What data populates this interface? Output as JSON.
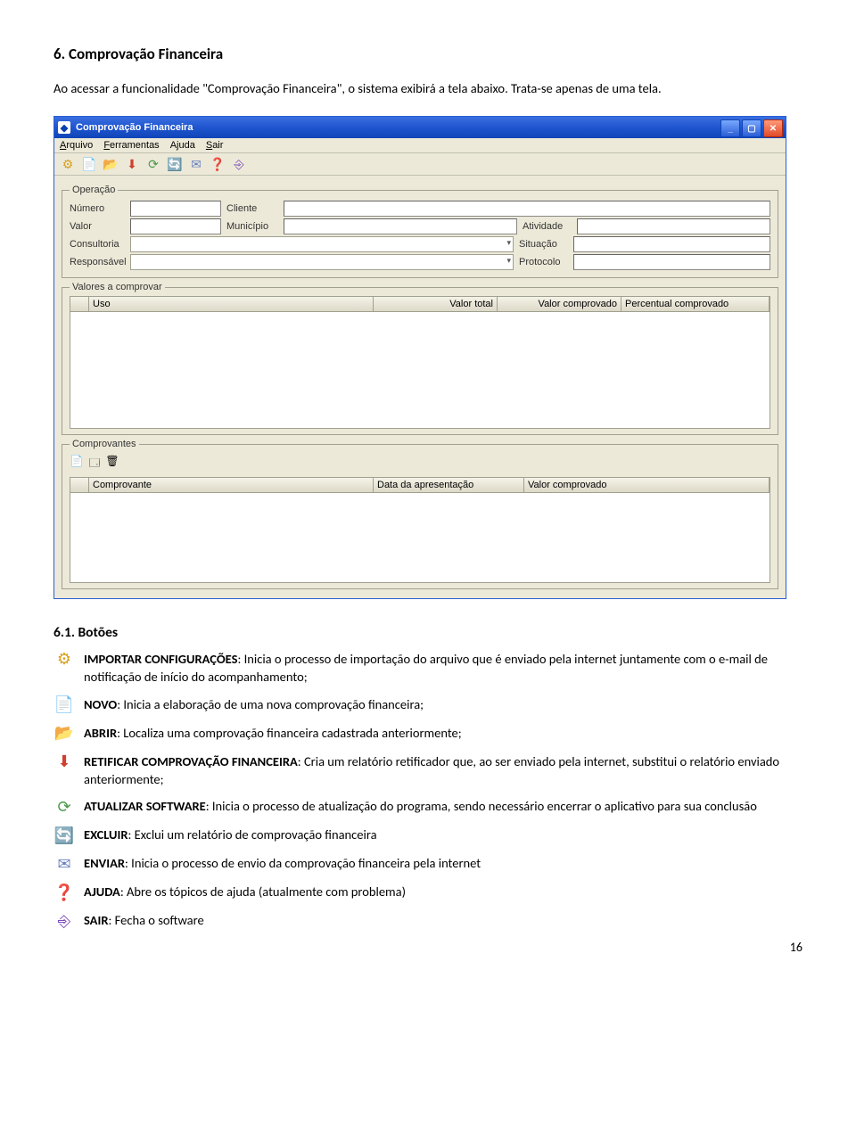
{
  "heading": "6. Comprovação Financeira",
  "intro": "Ao acessar a funcionalidade \"Comprovação Financeira\", o sistema exibirá a tela abaixo. Trata-se apenas de uma tela.",
  "window": {
    "title": "Comprovação Financeira",
    "menu": {
      "arquivo": "Arquivo",
      "ferramentas": "Ferramentas",
      "ajuda": "Ajuda",
      "sair": "Sair"
    },
    "operacao": {
      "legend": "Operação",
      "numero": "Número",
      "cliente": "Cliente",
      "valor": "Valor",
      "municipio": "Município",
      "atividade": "Atividade",
      "consultoria": "Consultoria",
      "situacao": "Situação",
      "responsavel": "Responsável",
      "protocolo": "Protocolo"
    },
    "valores": {
      "legend": "Valores a comprovar",
      "cols": {
        "uso": "Uso",
        "valortotal": "Valor total",
        "valorcomp": "Valor comprovado",
        "perc": "Percentual comprovado"
      }
    },
    "comprovantes": {
      "legend": "Comprovantes",
      "cols": {
        "comprovante": "Comprovante",
        "data": "Data da apresentação",
        "valor": "Valor comprovado"
      }
    }
  },
  "subhead": "6.1. Botões",
  "buttons": {
    "importar": {
      "label": "IMPORTAR CONFIGURAÇÕES",
      "desc": ": Inicia o processo de importação do arquivo que é enviado pela internet juntamente com o e-mail de notificação de início do acompanhamento;"
    },
    "novo": {
      "label": "NOVO",
      "desc": ": Inicia a elaboração de uma nova comprovação financeira;"
    },
    "abrir": {
      "label": "ABRIR",
      "desc": ": Localiza uma comprovação financeira cadastrada anteriormente;"
    },
    "retificar": {
      "label": "RETIFICAR COMPROVAÇÃO FINANCEIRA",
      "desc": ": Cria um relatório retificador que, ao ser enviado pela internet, substitui o relatório enviado anteriormente;"
    },
    "atualizar": {
      "label": "ATUALIZAR SOFTWARE",
      "desc": ": Inicia o processo de atualização do programa, sendo necessário encerrar o aplicativo para sua conclusão"
    },
    "excluir": {
      "label": "EXCLUIR",
      "desc": ": Exclui um relatório de comprovação financeira"
    },
    "enviar": {
      "label": "ENVIAR",
      "desc": ": Inicia o processo de envio da comprovação financeira pela internet"
    },
    "ajuda": {
      "label": "AJUDA",
      "desc": ": Abre os tópicos de ajuda (atualmente com problema)"
    },
    "sair": {
      "label": "SAIR",
      "desc": ": Fecha o software"
    }
  },
  "pagenum": "16"
}
